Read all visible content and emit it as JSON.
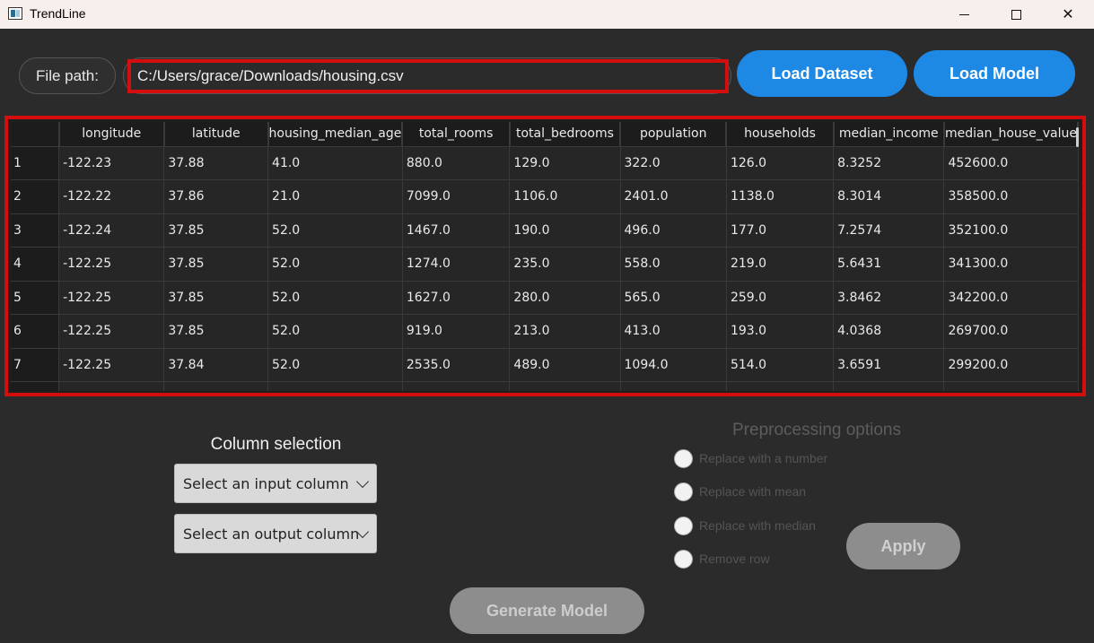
{
  "window": {
    "title": "TrendLine",
    "minimize_glyph": "",
    "close_glyph": "✕"
  },
  "file": {
    "label": "File path:",
    "path_value": "C:/Users/grace/Downloads/housing.csv"
  },
  "buttons": {
    "load_dataset": "Load Dataset",
    "load_model": "Load Model",
    "apply": "Apply",
    "generate_model": "Generate Model"
  },
  "table": {
    "headers": [
      "longitude",
      "latitude",
      "housing_median_age",
      "total_rooms",
      "total_bedrooms",
      "population",
      "households",
      "median_income",
      "median_house_value"
    ],
    "rows": [
      {
        "index": "1",
        "cells": [
          "-122.23",
          "37.88",
          "41.0",
          "880.0",
          "129.0",
          "322.0",
          "126.0",
          "8.3252",
          "452600.0"
        ]
      },
      {
        "index": "2",
        "cells": [
          "-122.22",
          "37.86",
          "21.0",
          "7099.0",
          "1106.0",
          "2401.0",
          "1138.0",
          "8.3014",
          "358500.0"
        ]
      },
      {
        "index": "3",
        "cells": [
          "-122.24",
          "37.85",
          "52.0",
          "1467.0",
          "190.0",
          "496.0",
          "177.0",
          "7.2574",
          "352100.0"
        ]
      },
      {
        "index": "4",
        "cells": [
          "-122.25",
          "37.85",
          "52.0",
          "1274.0",
          "235.0",
          "558.0",
          "219.0",
          "5.6431",
          "341300.0"
        ]
      },
      {
        "index": "5",
        "cells": [
          "-122.25",
          "37.85",
          "52.0",
          "1627.0",
          "280.0",
          "565.0",
          "259.0",
          "3.8462",
          "342200.0"
        ]
      },
      {
        "index": "6",
        "cells": [
          "-122.25",
          "37.85",
          "52.0",
          "919.0",
          "213.0",
          "413.0",
          "193.0",
          "4.0368",
          "269700.0"
        ]
      },
      {
        "index": "7",
        "cells": [
          "-122.25",
          "37.84",
          "52.0",
          "2535.0",
          "489.0",
          "1094.0",
          "514.0",
          "3.6591",
          "299200.0"
        ]
      },
      {
        "index": "",
        "cells": [
          "",
          "",
          "",
          "",
          "",
          "",
          "",
          "",
          ""
        ]
      }
    ]
  },
  "column_selection": {
    "title": "Column selection",
    "input_placeholder": "Select an input column",
    "output_placeholder": "Select an output column"
  },
  "preprocessing": {
    "title": "Preprocessing options",
    "options": [
      "Replace with a number",
      "Replace with mean",
      "Replace with median",
      "Remove row"
    ]
  },
  "colors": {
    "accent": "#1e88e5",
    "highlight_border": "#d40d0d",
    "disabled_button": "#8d8d8d",
    "background": "#2b2b2b"
  }
}
